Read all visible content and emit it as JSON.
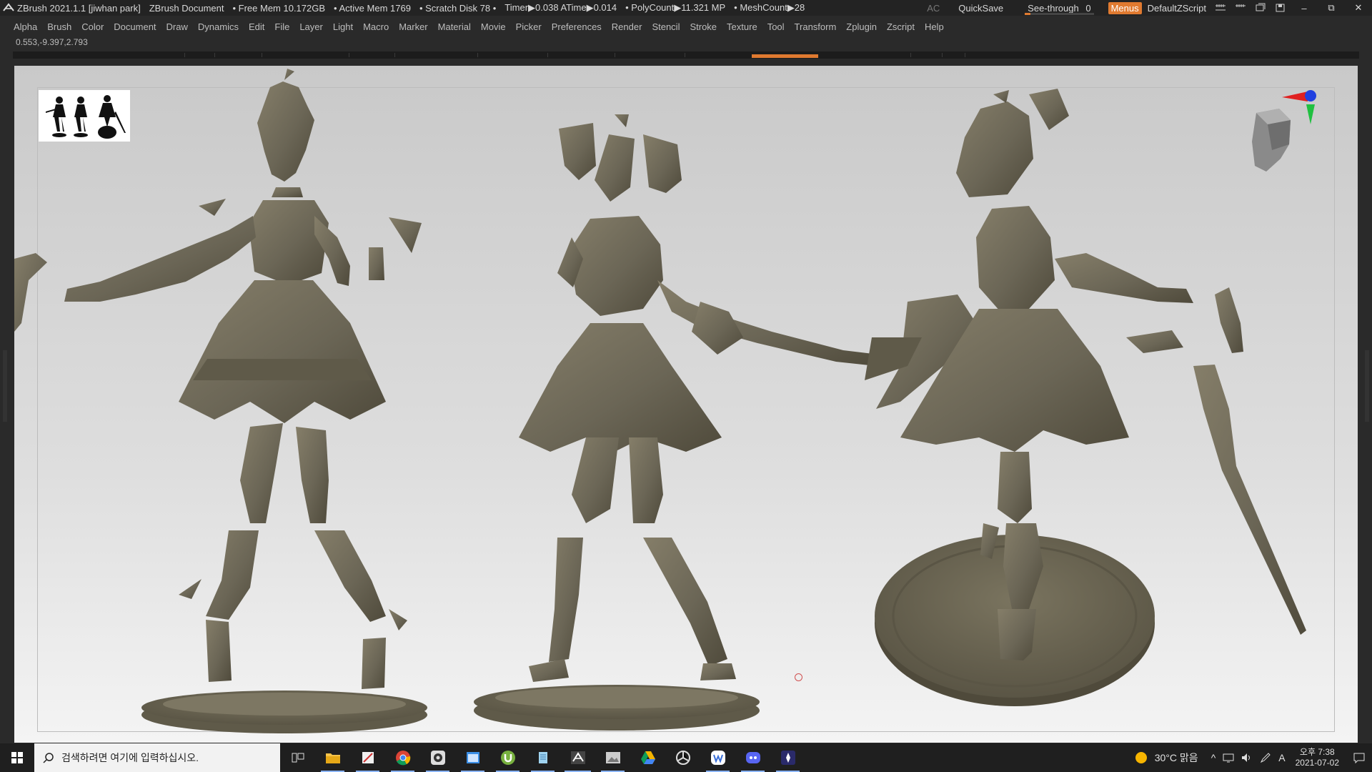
{
  "titlebar": {
    "app": "ZBrush 2021.1.1 [jiwhan park]",
    "document": "ZBrush Document",
    "free_mem": "• Free Mem 10.172GB",
    "active_mem": "• Active Mem 1769",
    "scratch": "• Scratch Disk 78 •",
    "timer": "Timer▶0.038 ATime▶0.014",
    "polycount": "• PolyCount▶11.321 MP",
    "meshcount": "• MeshCount▶28",
    "ac": "AC",
    "quicksave": "QuickSave",
    "see_through_label": "See-through",
    "see_through_value": "0",
    "menus": "Menus",
    "script": "DefaultZScript",
    "minimize": "–",
    "restore": "⧉",
    "close": "✕"
  },
  "menubar": {
    "items": [
      "Alpha",
      "Brush",
      "Color",
      "Document",
      "Draw",
      "Dynamics",
      "Edit",
      "File",
      "Layer",
      "Light",
      "Macro",
      "Marker",
      "Material",
      "Movie",
      "Picker",
      "Preferences",
      "Render",
      "Stencil",
      "Stroke",
      "Texture",
      "Tool",
      "Transform",
      "Zplugin",
      "Zscript",
      "Help"
    ]
  },
  "coords": "0.553,-9.397,2.793",
  "colors": {
    "accent": "#e07a30",
    "model": "#6b6656",
    "model_dark": "#55503f",
    "axis_x": "#e02020",
    "axis_y": "#20c040",
    "axis_z": "#2040e0"
  },
  "taskbar": {
    "search_placeholder": "검색하려면 여기에 입력하십시오.",
    "apps": [
      "task-view-icon",
      "file-explorer-icon",
      "snipping-tool-icon",
      "chrome-icon",
      "obs-icon",
      "zbrush-window-icon",
      "utorrent-icon",
      "notepad-icon",
      "zbrush-icon",
      "image-viewer-icon",
      "google-drive-icon",
      "unity-icon",
      "wattpad-icon",
      "discord-icon",
      "pureref-icon"
    ],
    "weather": "30°C 맑음",
    "ime": "A",
    "time": "오후 7:38",
    "date": "2021-07-02"
  }
}
